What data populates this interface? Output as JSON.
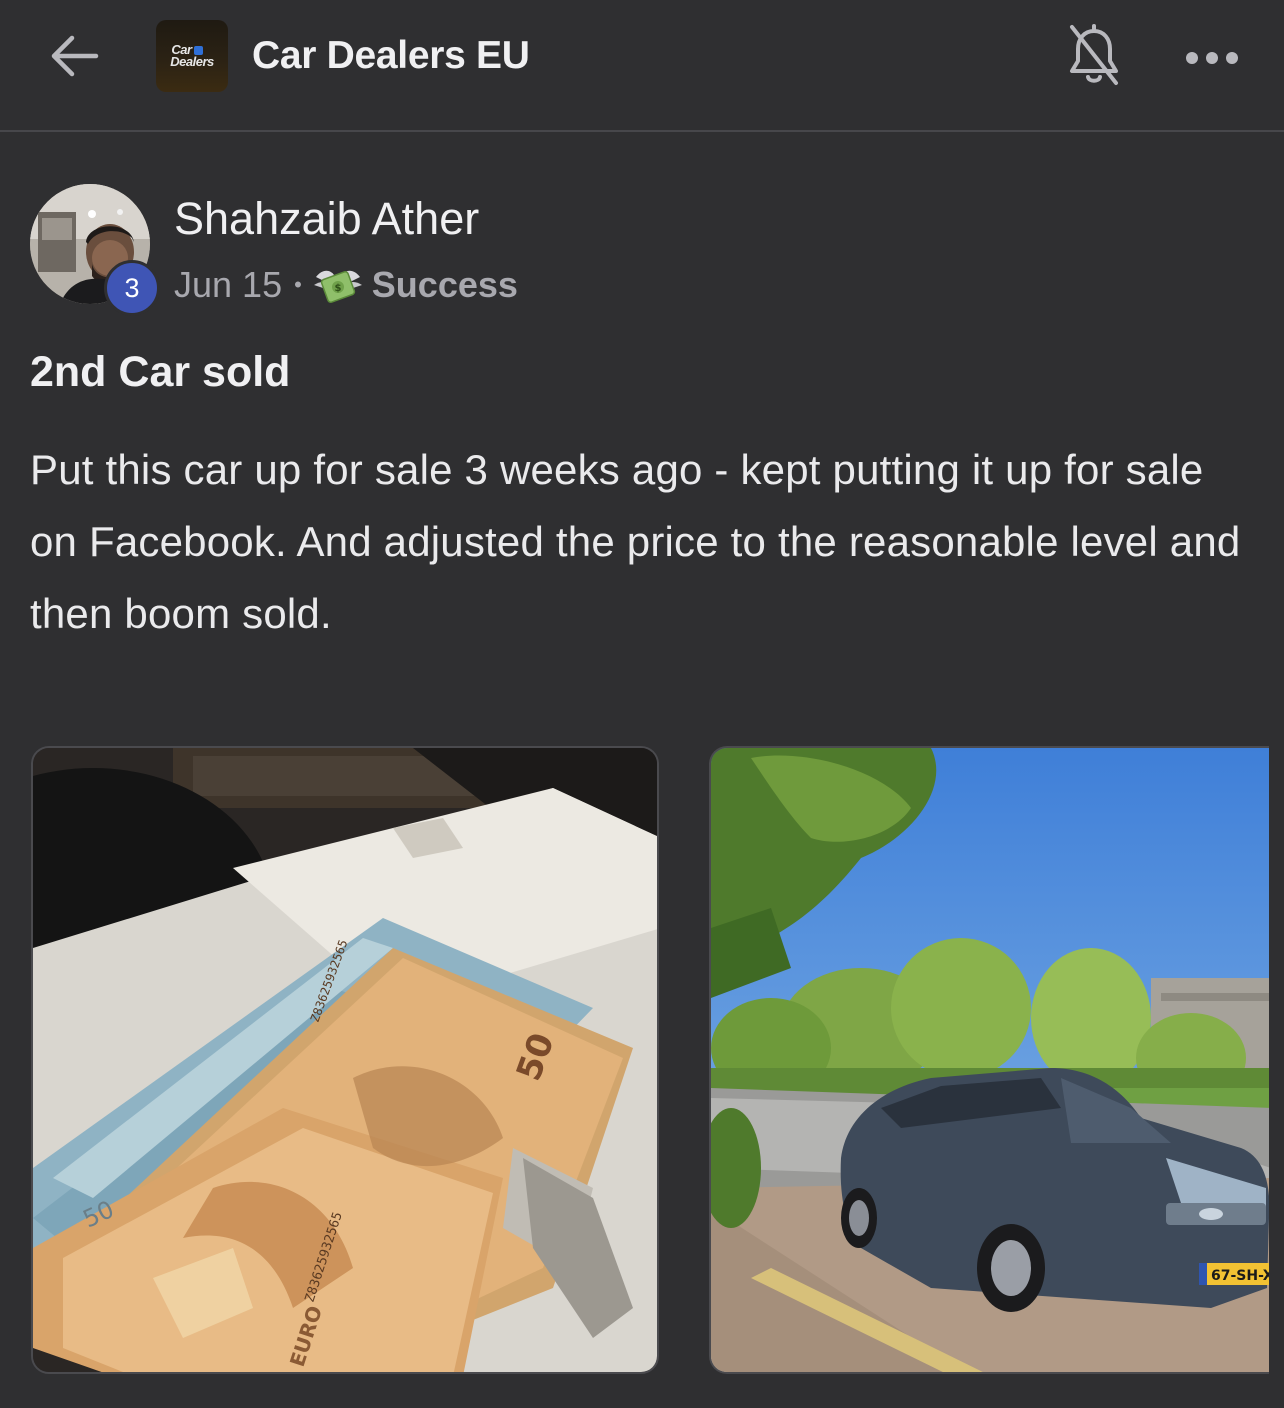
{
  "header": {
    "group_name": "Car Dealers EU",
    "logo_text_line1": "Car",
    "logo_text_line2": "Dealers"
  },
  "post": {
    "author": "Shahzaib Ather",
    "author_level": "3",
    "date": "Jun 15",
    "separator": "•",
    "category": "Success",
    "title": "2nd Car sold",
    "body": "Put this car up for sale 3 weeks ago - kept putting it up for sale on Facebook. And adjusted the price to the reasonable level and then boom sold."
  },
  "attachments": {
    "banknote_denomination": "50",
    "banknote_serial": "Z83625932565",
    "banknote_currency": "EURO",
    "license_plate": "67-SH-X"
  },
  "icons": {
    "back": "arrow-left-icon",
    "bell": "bell-off-icon",
    "more": "more-horizontal-icon",
    "category": "money-with-wings-icon"
  }
}
